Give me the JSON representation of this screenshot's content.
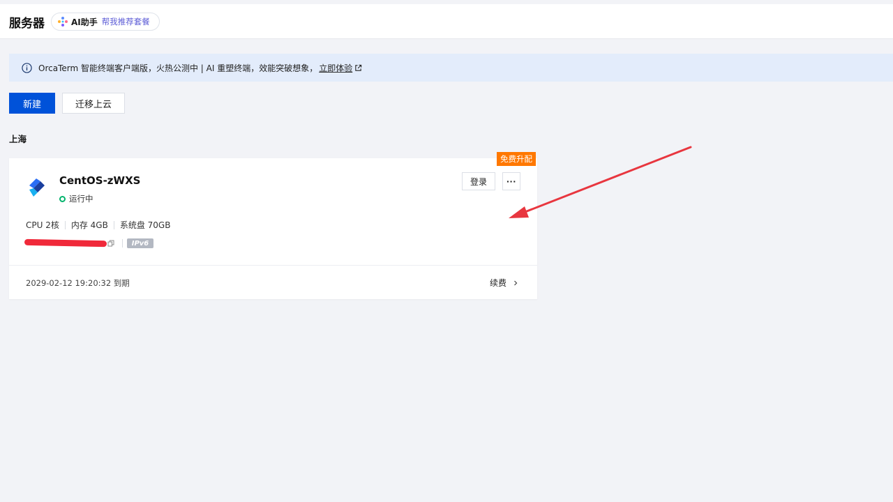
{
  "header": {
    "title": "服务器",
    "ai_label": "AI助手",
    "ai_link": "帮我推荐套餐"
  },
  "banner": {
    "text": "OrcaTerm 智能终端客户端版，火热公测中 | AI 重塑终端，效能突破想象，",
    "link": "立即体验"
  },
  "toolbar": {
    "new_label": "新建",
    "migrate_label": "迁移上云"
  },
  "region": "上海",
  "server": {
    "promo_tag": "免费升配",
    "name": "CentOS-zWXS",
    "status": "运行中",
    "status_color": "#00b36b",
    "login_label": "登录",
    "more_label": "···",
    "specs": [
      "CPU 2核",
      "内存 4GB",
      "系统盘 70GB"
    ],
    "ipv6_label": "IPv6",
    "expire_text": "2029-02-12 19:20:32 到期",
    "renew_label": "续费"
  },
  "colors": {
    "primary": "#0052d9",
    "promo": "#ff7800",
    "annotation_arrow": "#e8363f",
    "banner_bg": "#e3ecfb"
  }
}
